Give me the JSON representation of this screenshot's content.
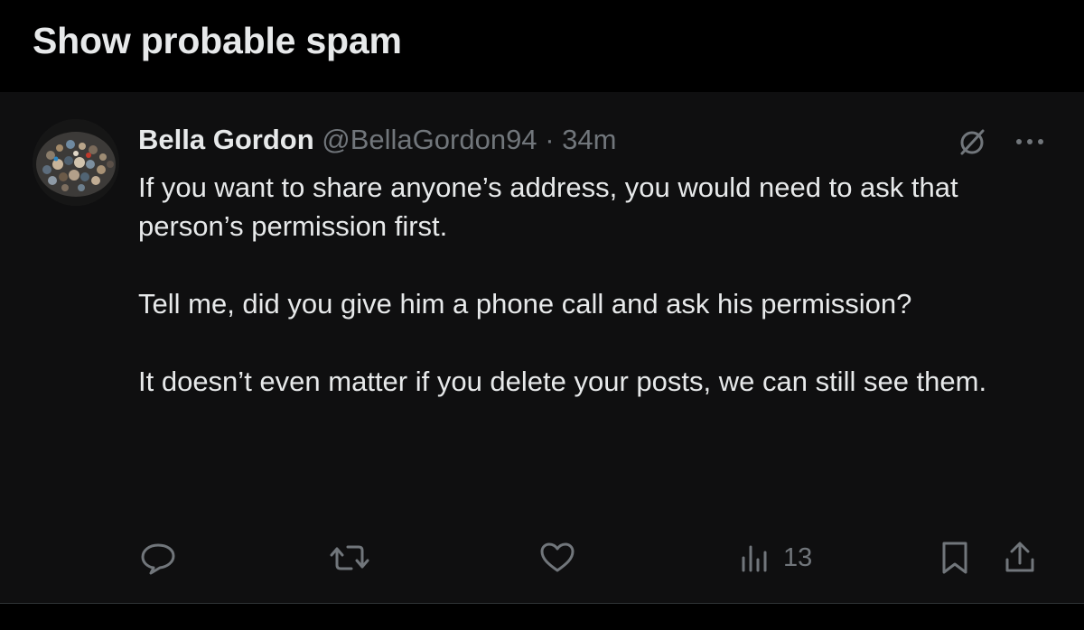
{
  "section": {
    "title": "Show probable spam"
  },
  "post": {
    "author": {
      "display_name": "Bella Gordon",
      "handle": "@BellaGordon94",
      "separator": "·",
      "time": "34m"
    },
    "paragraphs": [
      "If you want to share anyone’s address, you would need to ask that person’s permission first.",
      "Tell me, did you give him a phone call and ask his permission?",
      "It doesn’t even matter if you delete your posts, we can still see them."
    ],
    "metrics": {
      "views": "13"
    },
    "icons": {
      "grok": "grok-icon",
      "more": "more-icon",
      "reply": "reply-icon",
      "repost": "repost-icon",
      "like": "like-icon",
      "views": "views-icon",
      "bookmark": "bookmark-icon",
      "share": "share-icon"
    }
  },
  "colors": {
    "background": "#000000",
    "post_background": "#0f0f10",
    "primary_text": "#e7e9ea",
    "secondary_text": "#71767b",
    "divider": "#2f3336"
  }
}
